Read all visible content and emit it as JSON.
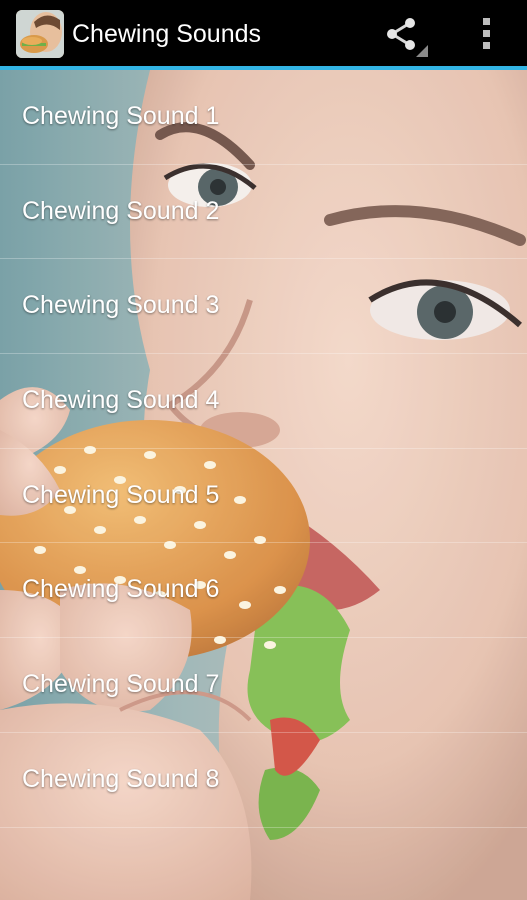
{
  "action_bar": {
    "title": "Chewing Sounds",
    "app_icon": "chewing-face-icon",
    "share_icon": "share-icon",
    "overflow_icon": "overflow-menu-icon",
    "background_color": "#000000",
    "accent_color": "#33b5e5"
  },
  "background": {
    "image": "woman-eating-burger-photo"
  },
  "sounds": {
    "items": [
      {
        "label": "Chewing Sound 1"
      },
      {
        "label": "Chewing Sound 2"
      },
      {
        "label": "Chewing Sound 3"
      },
      {
        "label": "Chewing Sound 4"
      },
      {
        "label": "Chewing Sound 5"
      },
      {
        "label": "Chewing Sound 6"
      },
      {
        "label": "Chewing Sound 7"
      },
      {
        "label": "Chewing Sound 8"
      }
    ]
  }
}
